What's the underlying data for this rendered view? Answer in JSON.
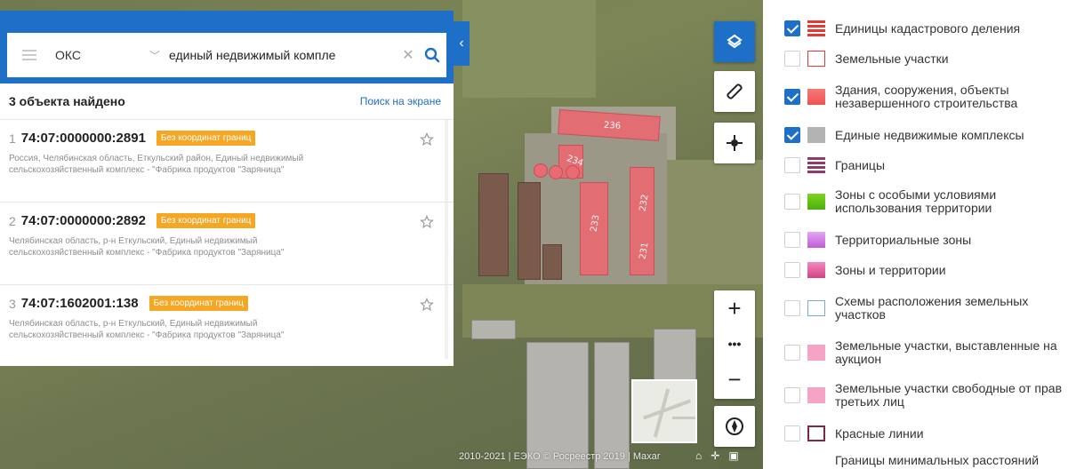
{
  "search": {
    "category": "ОКС",
    "query": "единый недвижимый компле"
  },
  "results": {
    "count_label": "3 объекта найдено",
    "screen_search_link": "Поиск на экране",
    "items": [
      {
        "num": "1",
        "cad": "74:07:0000000:2891",
        "badge": "Без координат границ",
        "addr1": "Россия, Челябинская область, Еткульский район, Единый недвижимый",
        "addr2": "сельскохозяйственный комплекс - \"Фабрика продуктов \"Заряница\""
      },
      {
        "num": "2",
        "cad": "74:07:0000000:2892",
        "badge": "Без координат границ",
        "addr1": "Челябинская область, р-н Еткульский, Единый недвижимый",
        "addr2": "сельскохозяйственный комплекс - \"Фабрика продуктов \"Заряница\""
      },
      {
        "num": "3",
        "cad": "74:07:1602001:138",
        "badge": "Без координат границ",
        "addr1": "Челябинская область, р-н Еткульский, Единый недвижимый",
        "addr2": "сельскохозяйственный комплекс - \"Фабрика продуктов \"Заряница\""
      }
    ]
  },
  "map": {
    "building_labels": [
      "236",
      "234",
      "233",
      "232",
      "231"
    ],
    "copyright": "2010-2021 | ЕЭКО © Росреестр 2019 | Maxar",
    "zoom_more": "•••"
  },
  "layers": [
    {
      "label": "Единицы кадастрового деления",
      "checked": true,
      "swatch": "stripe-red"
    },
    {
      "label": "Земельные участки",
      "checked": false,
      "swatch": "outline-red"
    },
    {
      "label": "Здания, сооружения, объекты незавершенного строительства",
      "checked": true,
      "swatch": "red-fill"
    },
    {
      "label": "Единые недвижимые комплексы",
      "checked": true,
      "swatch": "grey"
    },
    {
      "label": "Границы",
      "checked": false,
      "swatch": "stripe-purple"
    },
    {
      "label": "Зоны с особыми условиями использования территории",
      "checked": false,
      "swatch": "green"
    },
    {
      "label": "Территориальные зоны",
      "checked": false,
      "swatch": "violet"
    },
    {
      "label": "Зоны и территории",
      "checked": false,
      "swatch": "magenta"
    },
    {
      "label": "Схемы расположения земельных участков",
      "checked": false,
      "swatch": "outline-blue"
    },
    {
      "label": "Земельные участки, выставленные на аукцион",
      "checked": false,
      "swatch": "pink"
    },
    {
      "label": "Земельные участки свободные от прав третьих лиц",
      "checked": false,
      "swatch": "pink"
    },
    {
      "label": "Красные линии",
      "checked": false,
      "swatch": "outline-maroon"
    },
    {
      "label": "Границы минимальных расстояний",
      "checked": false,
      "swatch": "none"
    }
  ],
  "colors": {
    "accent": "#1d6fc7",
    "badge": "#f5a623",
    "building": "#e86a72"
  }
}
